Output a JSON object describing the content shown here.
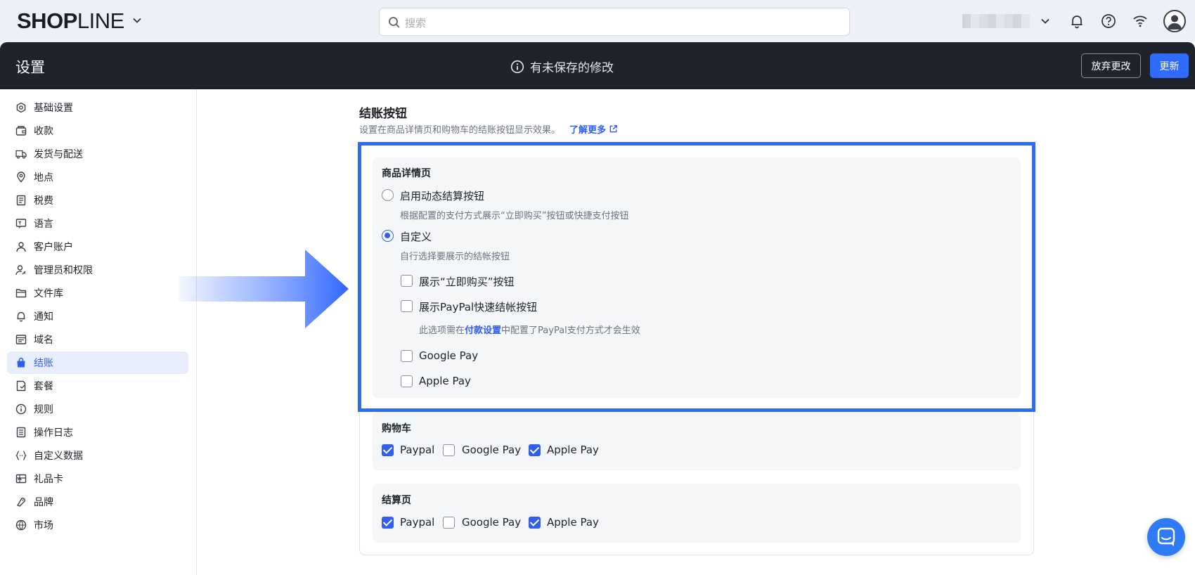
{
  "topbar": {
    "logo_bold": "SHOP",
    "logo_thin": "LINE",
    "search_placeholder": "搜索"
  },
  "header": {
    "title": "设置",
    "unsaved_text": "有未保存的修改",
    "discard_label": "放弃更改",
    "update_label": "更新"
  },
  "sidebar": {
    "items": [
      {
        "label": "基础设置",
        "icon": "settings-hex-icon"
      },
      {
        "label": "收款",
        "icon": "wallet-icon"
      },
      {
        "label": "发货与配送",
        "icon": "truck-icon"
      },
      {
        "label": "地点",
        "icon": "location-pin-icon"
      },
      {
        "label": "税费",
        "icon": "receipt-icon"
      },
      {
        "label": "语言",
        "icon": "language-icon"
      },
      {
        "label": "客户账户",
        "icon": "user-icon"
      },
      {
        "label": "管理员和权限",
        "icon": "user-key-icon"
      },
      {
        "label": "文件库",
        "icon": "folder-icon"
      },
      {
        "label": "通知",
        "icon": "bell-icon"
      },
      {
        "label": "域名",
        "icon": "browser-icon"
      },
      {
        "label": "结账",
        "icon": "shopping-bag-icon",
        "active": true
      },
      {
        "label": "套餐",
        "icon": "package-icon"
      },
      {
        "label": "规则",
        "icon": "info-circle-icon"
      },
      {
        "label": "操作日志",
        "icon": "log-icon"
      },
      {
        "label": "自定义数据",
        "icon": "code-braces-icon"
      },
      {
        "label": "礼品卡",
        "icon": "gift-card-icon"
      },
      {
        "label": "品牌",
        "icon": "brand-icon"
      },
      {
        "label": "市场",
        "icon": "globe-icon"
      }
    ]
  },
  "main": {
    "section_title": "结账按钮",
    "section_desc": "设置在商品详情页和购物车的结账按钮显示效果。",
    "learn_more": "了解更多",
    "product_page": {
      "label": "商品详情页",
      "option_dynamic": "启用动态结算按钮",
      "option_dynamic_hint": "根据配置的支付方式展示“立即购买”按钮或快捷支付按钮",
      "option_custom": "自定义",
      "option_custom_hint": "自行选择要展示的结帐按钮",
      "selected": "custom",
      "cb_buy_now": "展示“立即购买”按钮",
      "cb_paypal": "展示PayPal快速结帐按钮",
      "paypal_hint_pre": "此选项需在",
      "paypal_hint_link": "付款设置",
      "paypal_hint_post": "中配置了PayPal支付方式才会生效",
      "cb_google": "Google Pay",
      "cb_apple": "Apple Pay"
    },
    "cart": {
      "label": "购物车",
      "paypal": "Paypal",
      "google": "Google Pay",
      "apple": "Apple Pay"
    },
    "checkout": {
      "label": "结算页",
      "paypal": "Paypal",
      "google": "Google Pay",
      "apple": "Apple Pay"
    }
  },
  "colors": {
    "accent": "#2f5ff0",
    "highlight_border": "#2e6cf0",
    "header_bg": "#1f232b"
  }
}
